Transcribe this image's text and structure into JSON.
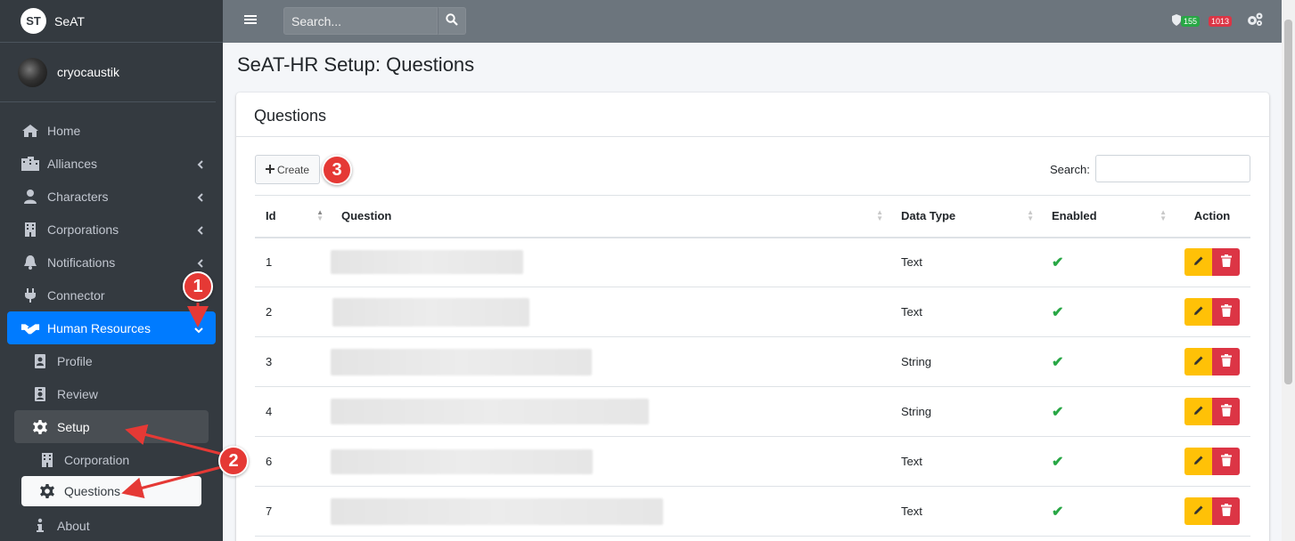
{
  "brand": {
    "logo": "ST",
    "name": "SeAT"
  },
  "user": {
    "name": "cryocaustik"
  },
  "sidebar": {
    "items": [
      {
        "label": "Home",
        "icon": "home-icon"
      },
      {
        "label": "Alliances",
        "icon": "building-icon"
      },
      {
        "label": "Characters",
        "icon": "user-icon"
      },
      {
        "label": "Corporations",
        "icon": "office-icon"
      },
      {
        "label": "Notifications",
        "icon": "bell-icon"
      },
      {
        "label": "Connector",
        "icon": "plug-icon"
      },
      {
        "label": "Human Resources",
        "icon": "handshake-icon"
      },
      {
        "label": "Profile",
        "icon": "id-card-icon"
      },
      {
        "label": "Review",
        "icon": "id-badge-icon"
      },
      {
        "label": "Setup",
        "icon": "gear-icon"
      },
      {
        "label": "Corporation",
        "icon": "office-icon"
      },
      {
        "label": "Questions",
        "icon": "gear-icon"
      },
      {
        "label": "About",
        "icon": "info-icon"
      }
    ]
  },
  "topbar": {
    "search_placeholder": "Search...",
    "badge_green": "155",
    "badge_red": "1013"
  },
  "page": {
    "title": "SeAT-HR Setup: Questions"
  },
  "card": {
    "title": "Questions",
    "create_label": "Create",
    "search_label": "Search:"
  },
  "table": {
    "headers": [
      "Id",
      "Question",
      "Data Type",
      "Enabled",
      "Action"
    ],
    "rows": [
      {
        "id": "1",
        "type": "Text"
      },
      {
        "id": "2",
        "type": "Text"
      },
      {
        "id": "3",
        "type": "String"
      },
      {
        "id": "4",
        "type": "String"
      },
      {
        "id": "6",
        "type": "Text"
      },
      {
        "id": "7",
        "type": "Text"
      }
    ]
  },
  "annotations": [
    "1",
    "2",
    "3"
  ],
  "colors": {
    "primary": "#007bff",
    "sidebar": "#343a40",
    "topbar": "#6c757d",
    "success": "#28a745",
    "warning": "#ffc107",
    "danger": "#dc3545",
    "annotation": "#e53935"
  }
}
